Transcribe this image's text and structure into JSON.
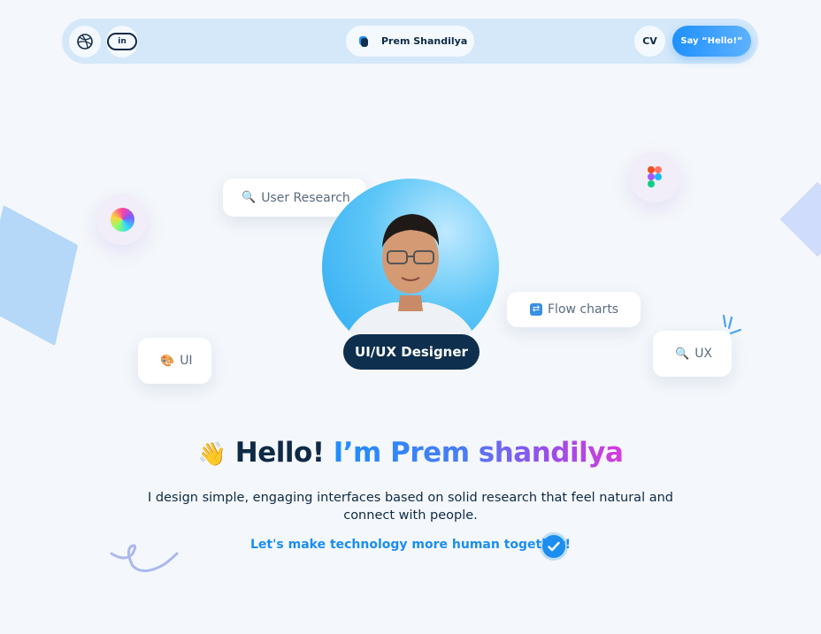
{
  "nav": {
    "dribbble_icon": "dribbble-icon",
    "linkedin_label": "in",
    "brand_name": "Prem Shandilya",
    "cv_label": "CV",
    "cta_label": "Say “Hello!”"
  },
  "chips": {
    "user_research": "User Research",
    "flow_charts": "Flow charts",
    "ui": "UI",
    "ux": "UX"
  },
  "hero": {
    "role": "UI/UX Designer",
    "greeting": "Hello!",
    "intro": "I’m Prem shandilya",
    "description": "I design simple, engaging interfaces based on solid research that feel natural and connect with people.",
    "tagline": "Let's make technology more human together!"
  },
  "colors": {
    "accent": "#1b8ef0",
    "dark": "#0e2f4d",
    "background": "#f4f7fb",
    "nav_bg": "#d4e8f9"
  }
}
